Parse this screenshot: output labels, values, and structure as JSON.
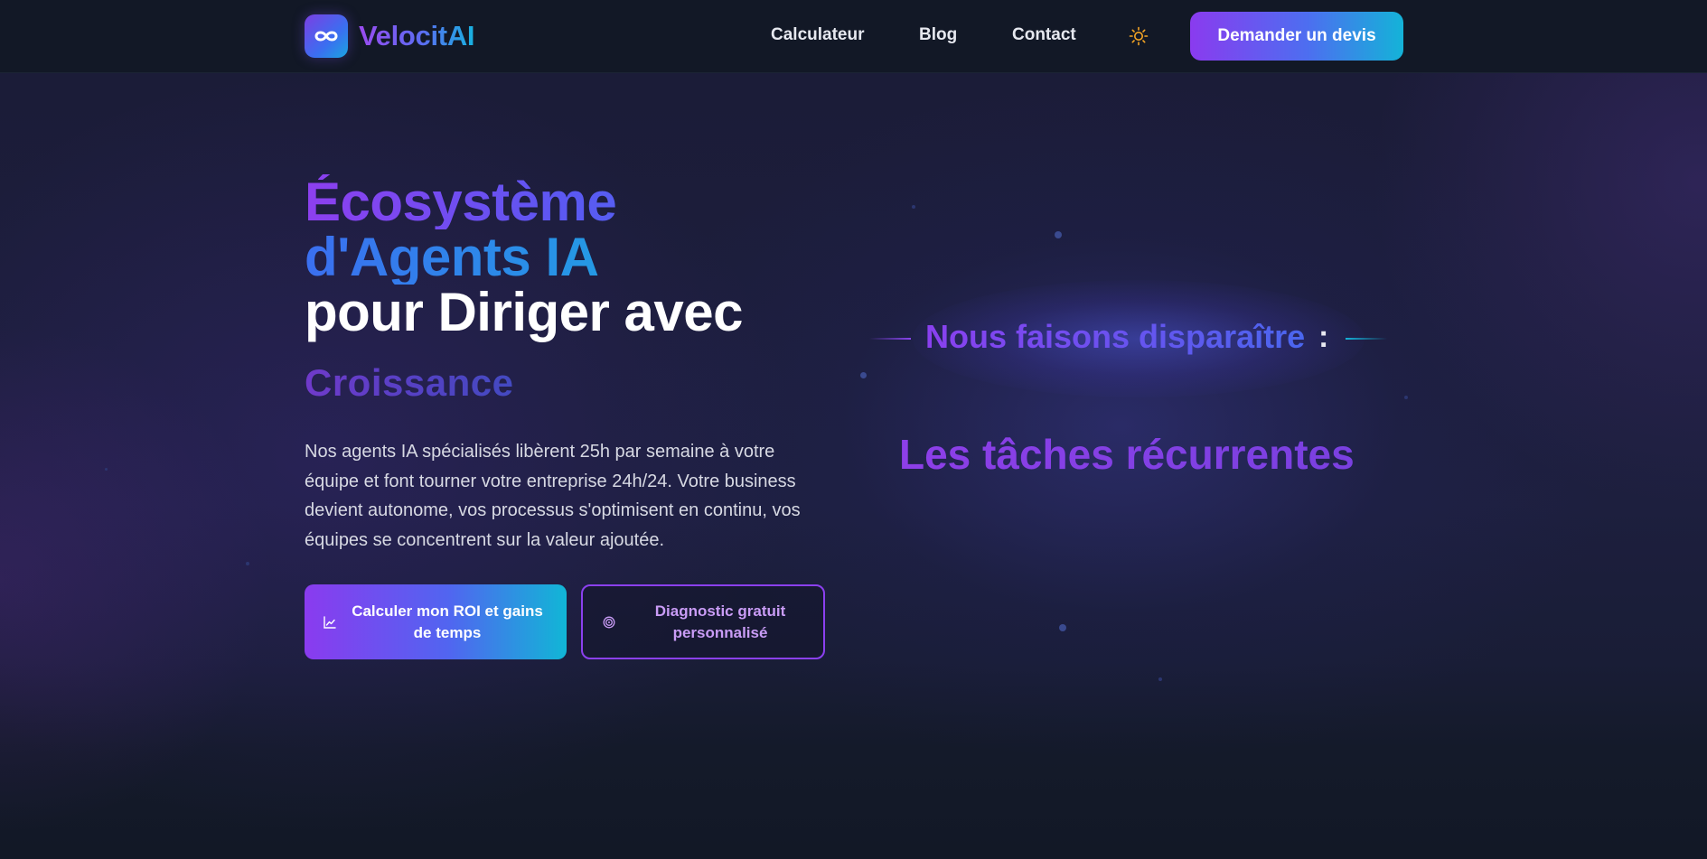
{
  "header": {
    "brand": "VelocitAI",
    "logo_icon": "infinity-icon",
    "nav": [
      {
        "label": "Calculateur"
      },
      {
        "label": "Blog"
      },
      {
        "label": "Contact"
      }
    ],
    "theme_toggle_icon": "sun-icon",
    "cta_label": "Demander un devis"
  },
  "hero": {
    "title_line1": "Écosystème",
    "title_line2": "d'Agents IA",
    "title_line3": "pour Diriger avec",
    "rotating_word": "Croissance",
    "description": "Nos agents IA spécialisés libèrent 25h par semaine à votre équipe et font tourner votre entreprise 24h/24. Votre business devient autonome, vos processus s'optimisent en continu, vos équipes se concentrent sur la valeur ajoutée.",
    "primary_button": {
      "label": "Calculer mon ROI et gains de temps",
      "icon": "chart-line-icon"
    },
    "secondary_button": {
      "label": "Diagnostic gratuit personnalisé",
      "icon": "target-icon"
    }
  },
  "showcase": {
    "heading": "Nous faisons disparaître",
    "colon": ":",
    "task": "Les tâches récurrentes"
  },
  "colors": {
    "background": "#121826",
    "accent_purple": "#8a3bef",
    "accent_blue": "#4d6ef0",
    "accent_cyan": "#14b3d8",
    "sun_icon": "#f5a524"
  }
}
